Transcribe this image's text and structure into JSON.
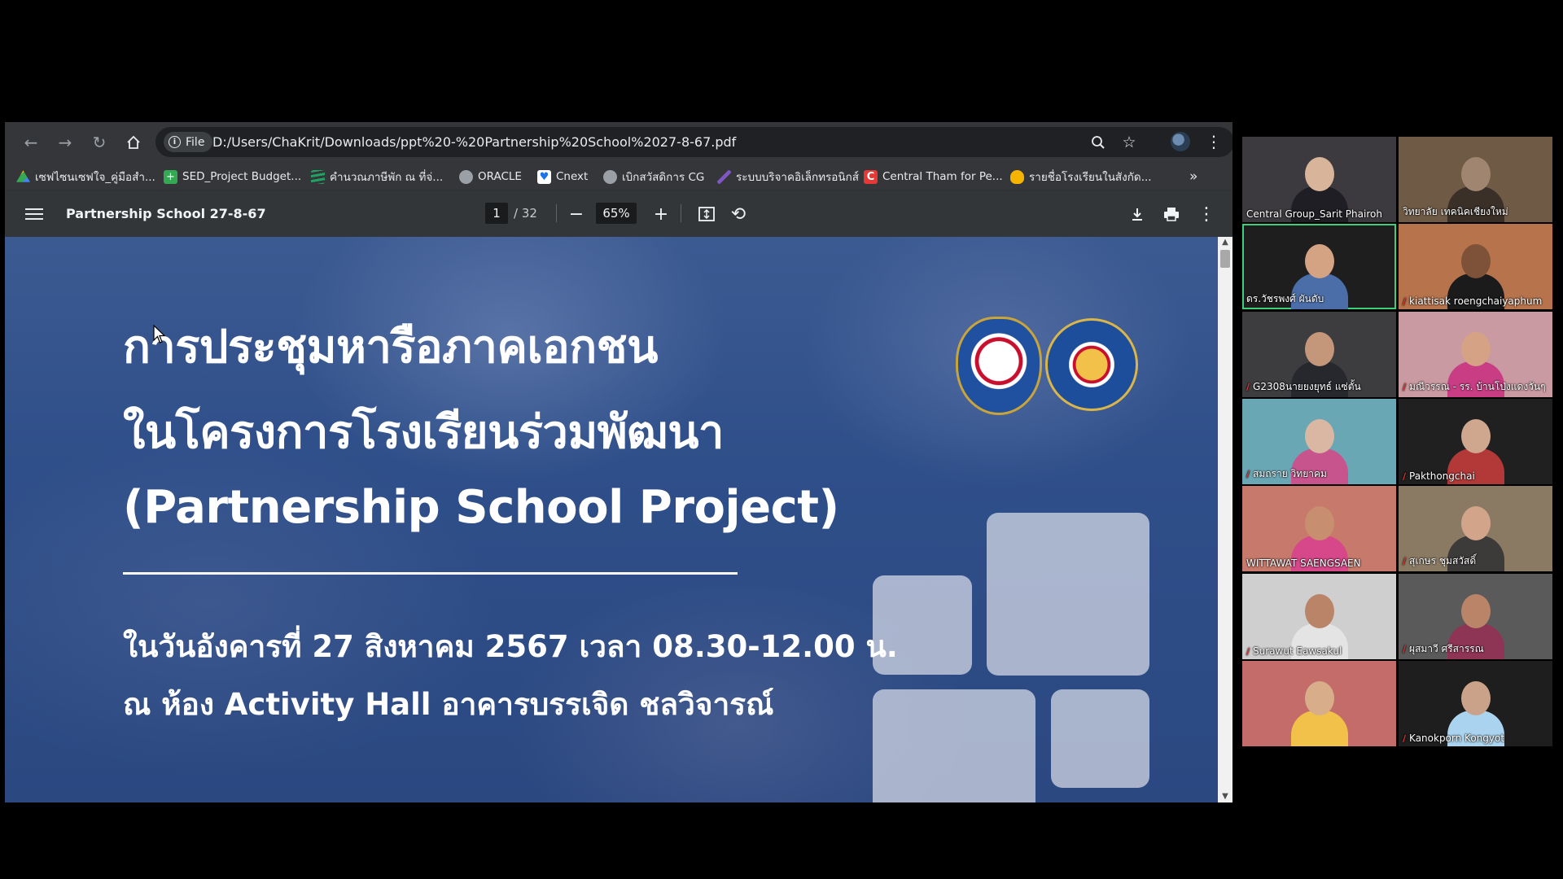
{
  "browser": {
    "url_chip": "File",
    "url": "D:/Users/ChaKrit/Downloads/ppt%20-%20Partnership%20School%2027-8-67.pdf",
    "bookmarks": [
      {
        "label": "เซฟไซนเซฟใจ_คู่มือสำ...",
        "icon": "google-drive-icon",
        "color": "#fbbc04"
      },
      {
        "label": "SED_Project Budget...",
        "icon": "sheets-icon",
        "color": "#34a853"
      },
      {
        "label": "คำนวณภาษีพัก ณ ที่จ่...",
        "icon": "stripes-icon",
        "color": "#1ea362"
      },
      {
        "label": "ORACLE",
        "icon": "globe-icon",
        "color": "#9aa0a6"
      },
      {
        "label": "Cnext",
        "icon": "heart-icon",
        "color": "#1a73e8"
      },
      {
        "label": "เบิกสวัสดิการ CG",
        "icon": "globe-icon",
        "color": "#9aa0a6"
      },
      {
        "label": "ระบบบริจาคอิเล็กทรอนิกส์",
        "icon": "feather-icon",
        "color": "#7e57c2"
      },
      {
        "label": "Central Tham for Pe...",
        "icon": "central-c-icon",
        "color": "#e53935"
      },
      {
        "label": "รายชื่อโรงเรียนในสังกัด...",
        "icon": "bulb-icon",
        "color": "#f6b300"
      }
    ]
  },
  "pdf": {
    "title": "Partnership School 27-8-67",
    "page": "1",
    "total": "/ 32",
    "zoom": "65%"
  },
  "slide": {
    "line1": "การประชุมหารือภาคเอกชน",
    "line2": "ในโครงการโรงเรียนร่วมพัฒนา",
    "line3": "(Partnership School Project)",
    "date_line": "ในวันอังคารที่ 27 สิงหาคม 2567 เวลา 08.30-12.00 น.",
    "venue_line": "ณ ห้อง Activity Hall อาคารบรรเจิด ชลวิจารณ์"
  },
  "participants": [
    {
      "name": "Central Group_Sarit Phairoh",
      "muted": false,
      "bg": "#3c3a3e",
      "head": "#d8b49a",
      "body": "#1e1e24"
    },
    {
      "name": "วิทยาลัย เทคนิคเชียงใหม่",
      "muted": false,
      "bg": "#6f5a45",
      "head": "#a08670",
      "body": "#3a3028"
    },
    {
      "name": "ดร.วัชรพงศ์ ผันดับ",
      "muted": false,
      "bg": "#1e1e1e",
      "head": "#d4a384",
      "body": "#4b6ea8"
    },
    {
      "name": "kiattisak roengchaiyaphum",
      "muted": true,
      "bg": "#b7734c",
      "head": "#7d5238",
      "body": "#1b1b1b"
    },
    {
      "name": "G2308นายยงยุทธ์ แซ่ตั้น",
      "muted": true,
      "bg": "#3d3d40",
      "head": "#c4967a",
      "body": "#26282e"
    },
    {
      "name": "มณีวรรณ - รร. บ้านโป่งแดงวันๆ",
      "muted": true,
      "bg": "#c99aa1",
      "head": "#d5a286",
      "body": "#c93d84"
    },
    {
      "name": "สมถราย วิทยาคม",
      "muted": true,
      "bg": "#6aa7b5",
      "head": "#d9b7a3",
      "body": "#c7548d"
    },
    {
      "name": "Pakthongchai",
      "muted": true,
      "bg": "#202020",
      "head": "#cfa78f",
      "body": "#b33939"
    },
    {
      "name": "WITTAWAT SAENGSAEN",
      "muted": false,
      "bg": "#c77a6c",
      "head": "#c78e6f",
      "body": "#d64889"
    },
    {
      "name": "สุเกษร ชุมสวัสดิ์",
      "muted": true,
      "bg": "#8a7a63",
      "head": "#d2a58a",
      "body": "#3d3a3a"
    },
    {
      "name": "Surawut Eawsakul",
      "muted": true,
      "bg": "#cfcfcf",
      "head": "#b98468",
      "body": "#e4e4e4"
    },
    {
      "name": "ผุสมาวี ศรีสารรณ",
      "muted": true,
      "bg": "#5a5a5a",
      "head": "#b98468",
      "body": "#8e3455"
    },
    {
      "name": "",
      "muted": false,
      "bg": "#c46c6a",
      "head": "#d8ae8a",
      "body": "#f2c14a"
    },
    {
      "name": "Kanokporn Kongyot",
      "muted": true,
      "bg": "#1e1e1e",
      "head": "#caa28a",
      "body": "#a9d3ee"
    }
  ]
}
